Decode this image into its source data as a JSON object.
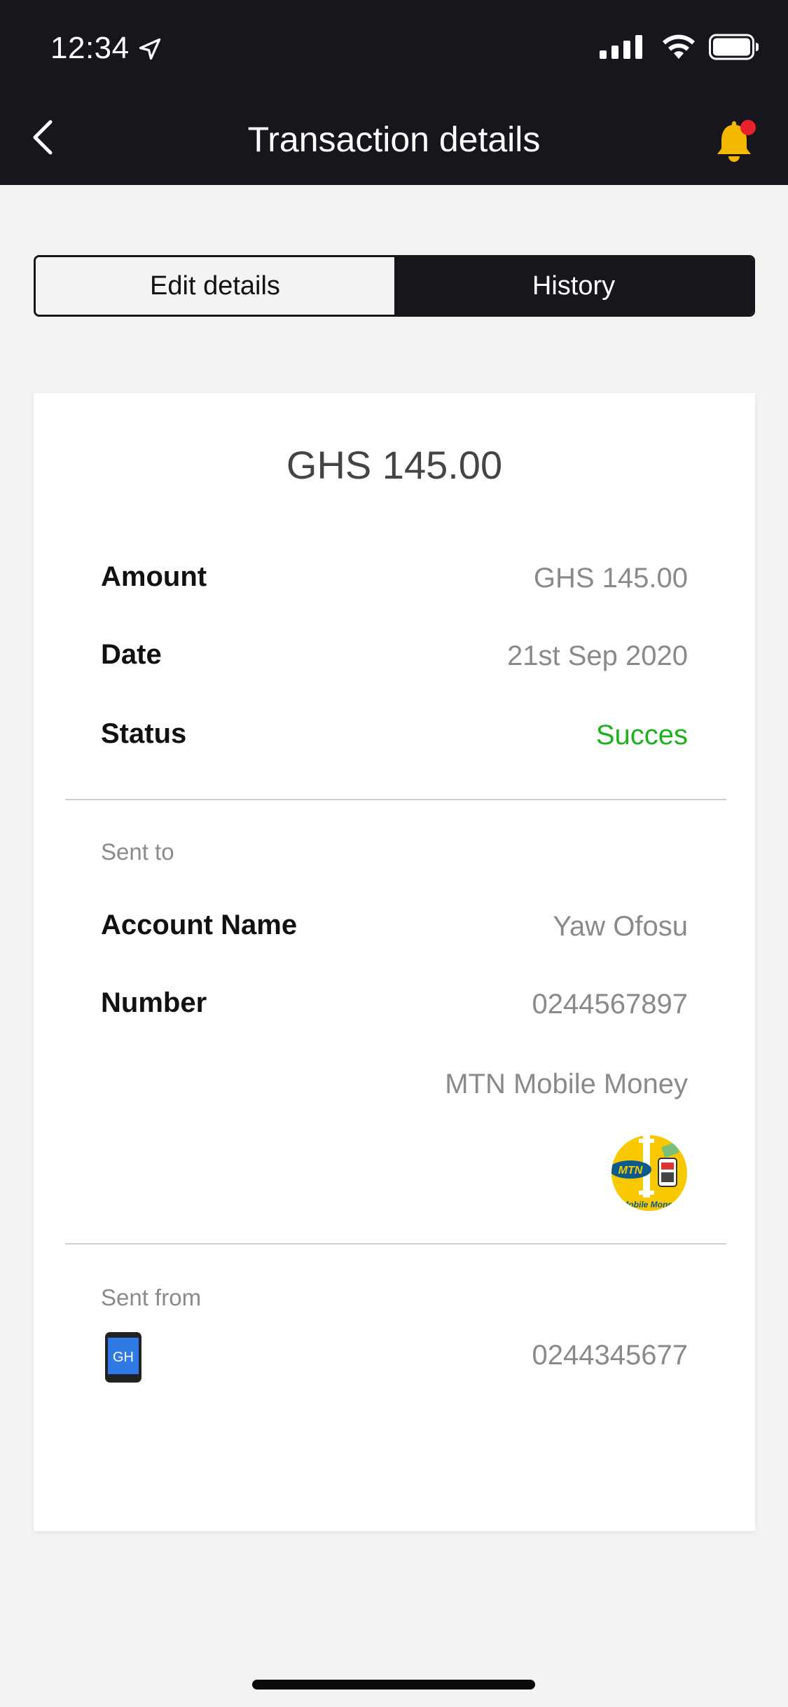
{
  "status_bar": {
    "time": "12:34",
    "icons": [
      "location-arrow-icon",
      "signal-icon",
      "wifi-icon",
      "battery-icon"
    ]
  },
  "header": {
    "title": "Transaction details",
    "back_icon": "chevron-left-icon",
    "notification_icon": "bell-icon"
  },
  "tabs": {
    "edit_label": "Edit details",
    "history_label": "History"
  },
  "transaction": {
    "headline_amount": "GHS 145.00",
    "amount_label": "Amount",
    "amount_value": "GHS 145.00",
    "date_label": "Date",
    "date_value": "21st Sep 2020",
    "status_label": "Status",
    "status_value": "Succes"
  },
  "sent_to": {
    "section_label": "Sent to",
    "account_name_label": "Account Name",
    "account_name_value": "Yaw Ofosu",
    "number_label": "Number",
    "number_value": "0244567897",
    "network": "MTN Mobile Money",
    "network_logo_text": "MTN",
    "network_logo_subtext": "Mobile Money"
  },
  "sent_from": {
    "section_label": "Sent from",
    "phone_badge": "GH",
    "number_value": "0244345677"
  },
  "colors": {
    "header_bg": "#16161c",
    "success": "#1db21d",
    "bell": "#f5b800",
    "badge_dot": "#e8222a",
    "mtn_yellow": "#f8c800",
    "phone_screen": "#2f7ae5"
  }
}
